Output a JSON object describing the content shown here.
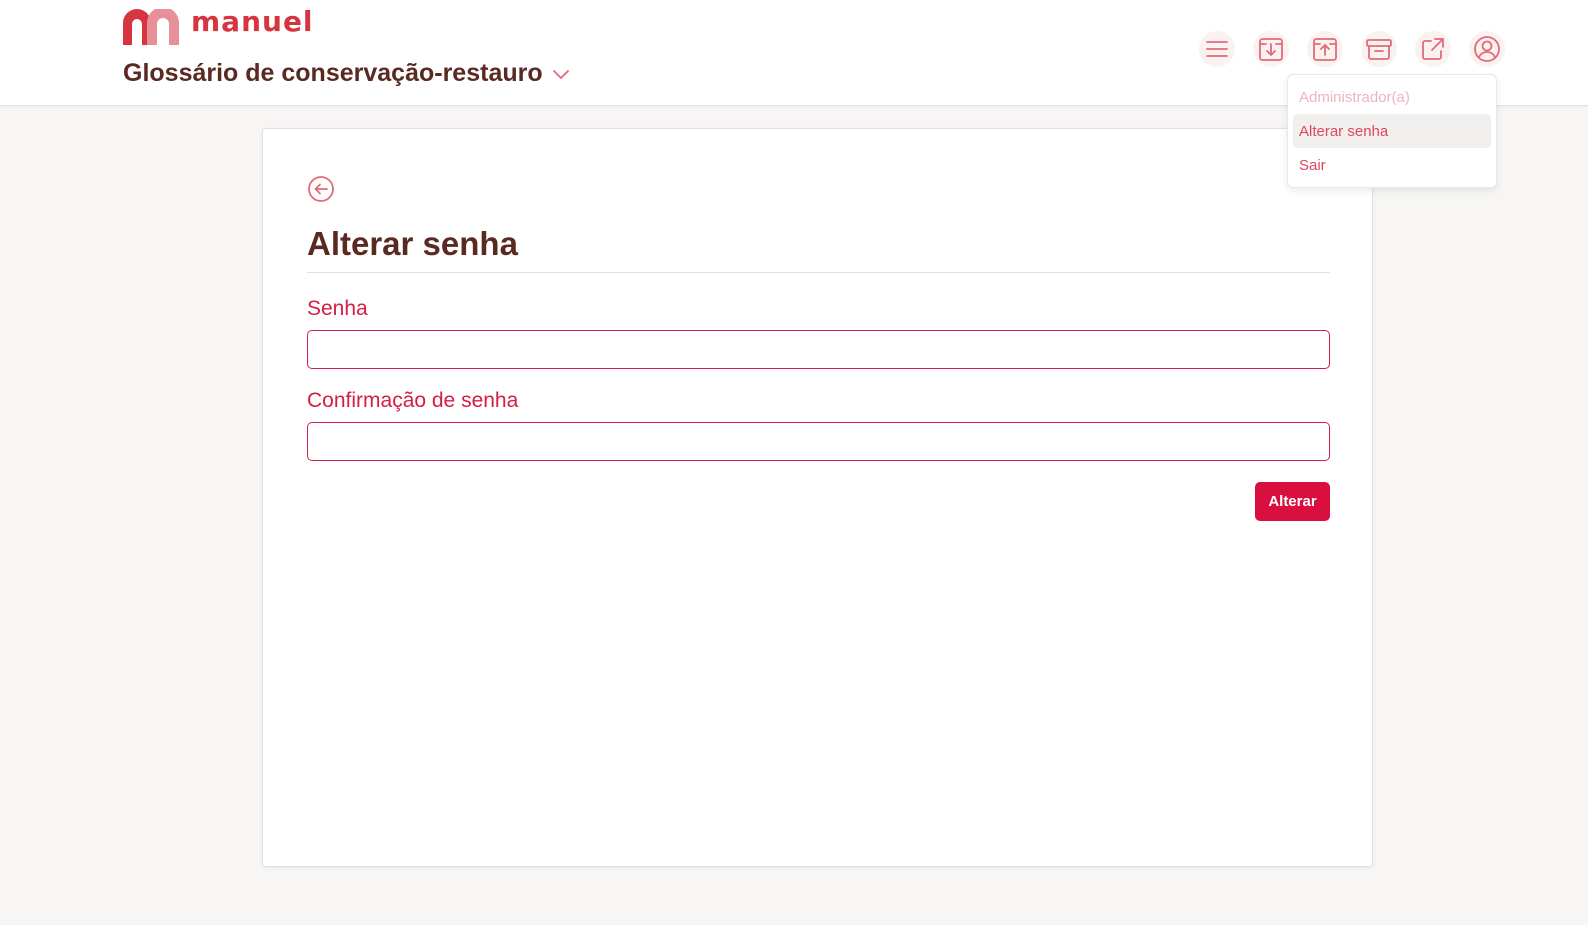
{
  "brand": {
    "name": "manuel",
    "accent": "#d6343f",
    "accent_light": "#e8909a"
  },
  "header": {
    "project_title": "Glossário de conservação-restauro",
    "toolbar": [
      {
        "icon": "menu-icon"
      },
      {
        "icon": "import-icon"
      },
      {
        "icon": "export-icon"
      },
      {
        "icon": "archive-icon"
      },
      {
        "icon": "external-link-icon"
      },
      {
        "icon": "user-circle-icon"
      }
    ]
  },
  "user_menu": {
    "role": "Administrador(a)",
    "items": [
      {
        "label": "Alterar senha",
        "active": true
      },
      {
        "label": "Sair",
        "active": false
      }
    ]
  },
  "form": {
    "title": "Alterar senha",
    "fields": [
      {
        "label": "Senha",
        "value": ""
      },
      {
        "label": "Confirmação de senha",
        "value": ""
      }
    ],
    "submit_label": "Alterar"
  },
  "colors": {
    "title": "#5a2a22",
    "label": "#d41e45",
    "button": "#d9103f",
    "icon": "#e36a78"
  }
}
